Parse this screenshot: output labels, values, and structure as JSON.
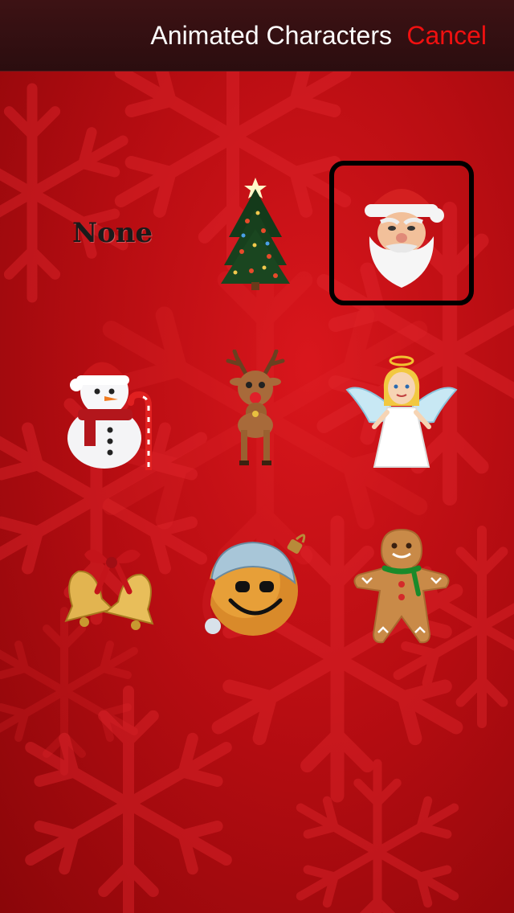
{
  "header": {
    "title": "Animated Characters",
    "cancel_label": "Cancel"
  },
  "characters": [
    {
      "label": "None",
      "icon": "none-option",
      "selected": false
    },
    {
      "icon": "christmas-tree-icon",
      "selected": false
    },
    {
      "icon": "santa-claus-icon",
      "selected": true
    },
    {
      "icon": "snowman-icon",
      "selected": false
    },
    {
      "icon": "reindeer-icon",
      "selected": false
    },
    {
      "icon": "angel-icon",
      "selected": false
    },
    {
      "icon": "christmas-bells-icon",
      "selected": false
    },
    {
      "icon": "ornament-smiley-icon",
      "selected": false
    },
    {
      "icon": "gingerbread-man-icon",
      "selected": false
    }
  ],
  "colors": {
    "background": "#c01015",
    "header_bg": "#2e0e10",
    "cancel": "#f01010",
    "selection_border": "#000000"
  }
}
